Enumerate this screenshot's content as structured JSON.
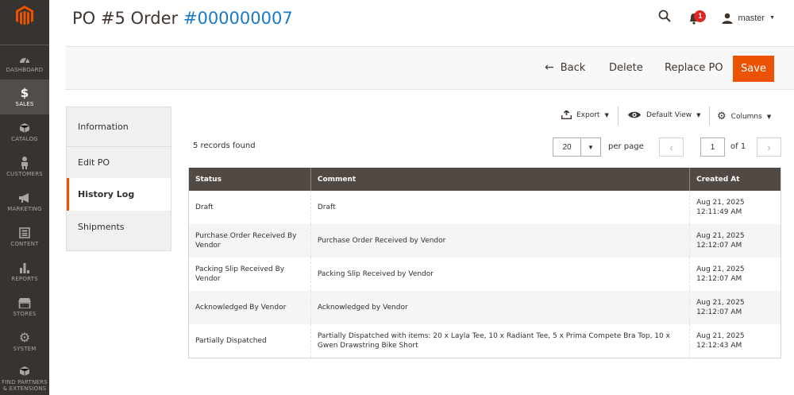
{
  "sidebar": {
    "items": [
      {
        "label": "DASHBOARD",
        "icon": "dashboard-icon"
      },
      {
        "label": "SALES",
        "icon": "dollar-icon",
        "active": true
      },
      {
        "label": "CATALOG",
        "icon": "cube-icon"
      },
      {
        "label": "CUSTOMERS",
        "icon": "person-icon"
      },
      {
        "label": "MARKETING",
        "icon": "megaphone-icon"
      },
      {
        "label": "CONTENT",
        "icon": "content-icon"
      },
      {
        "label": "REPORTS",
        "icon": "bar-chart-icon"
      },
      {
        "label": "STORES",
        "icon": "store-icon"
      },
      {
        "label": "SYSTEM",
        "icon": "gear-icon"
      },
      {
        "label": "FIND PARTNERS",
        "label2": "& EXTENSIONS",
        "icon": "box-icon"
      }
    ]
  },
  "header": {
    "title_prefix": "PO #5 Order ",
    "title_number": "#000000007",
    "notification_count": "1",
    "username": "master"
  },
  "actions": {
    "back": "Back",
    "delete": "Delete",
    "replace": "Replace PO",
    "save": "Save"
  },
  "tabs": [
    "Information",
    "Edit PO",
    "History Log",
    "Shipments"
  ],
  "toolbar": {
    "export": "Export",
    "view": "Default View",
    "columns": "Columns",
    "records": "5 records found",
    "per_page_value": "20",
    "per_page_label": "per page",
    "page": "1",
    "page_of": "of 1"
  },
  "table": {
    "headers": [
      "Status",
      "Comment",
      "Created At"
    ],
    "rows": [
      {
        "status": "Draft",
        "comment": "Draft",
        "created": "Aug 21, 2025 12:11:49 AM"
      },
      {
        "status": "Purchase Order Received By Vendor",
        "comment": "Purchase Order Received by Vendor",
        "created": "Aug 21, 2025 12:12:07 AM"
      },
      {
        "status": "Packing Slip Received By Vendor",
        "comment": "Packing Slip Received by Vendor",
        "created": "Aug 21, 2025 12:12:07 AM"
      },
      {
        "status": "Acknowledged By Vendor",
        "comment": "Acknowledged by Vendor",
        "created": "Aug 21, 2025 12:12:07 AM"
      },
      {
        "status": "Partially Dispatched",
        "comment": "Partially Dispatched with items: 20 x Layla Tee, 10 x Radiant Tee, 5 x Prima Compete Bra Top, 10 x Gwen Drawstring Bike Short",
        "created": "Aug 21, 2025 12:12:43 AM"
      }
    ]
  },
  "colors": {
    "accent": "#eb5202",
    "link": "#1979c3",
    "sidebar_bg": "#373330",
    "table_header": "#514943"
  }
}
